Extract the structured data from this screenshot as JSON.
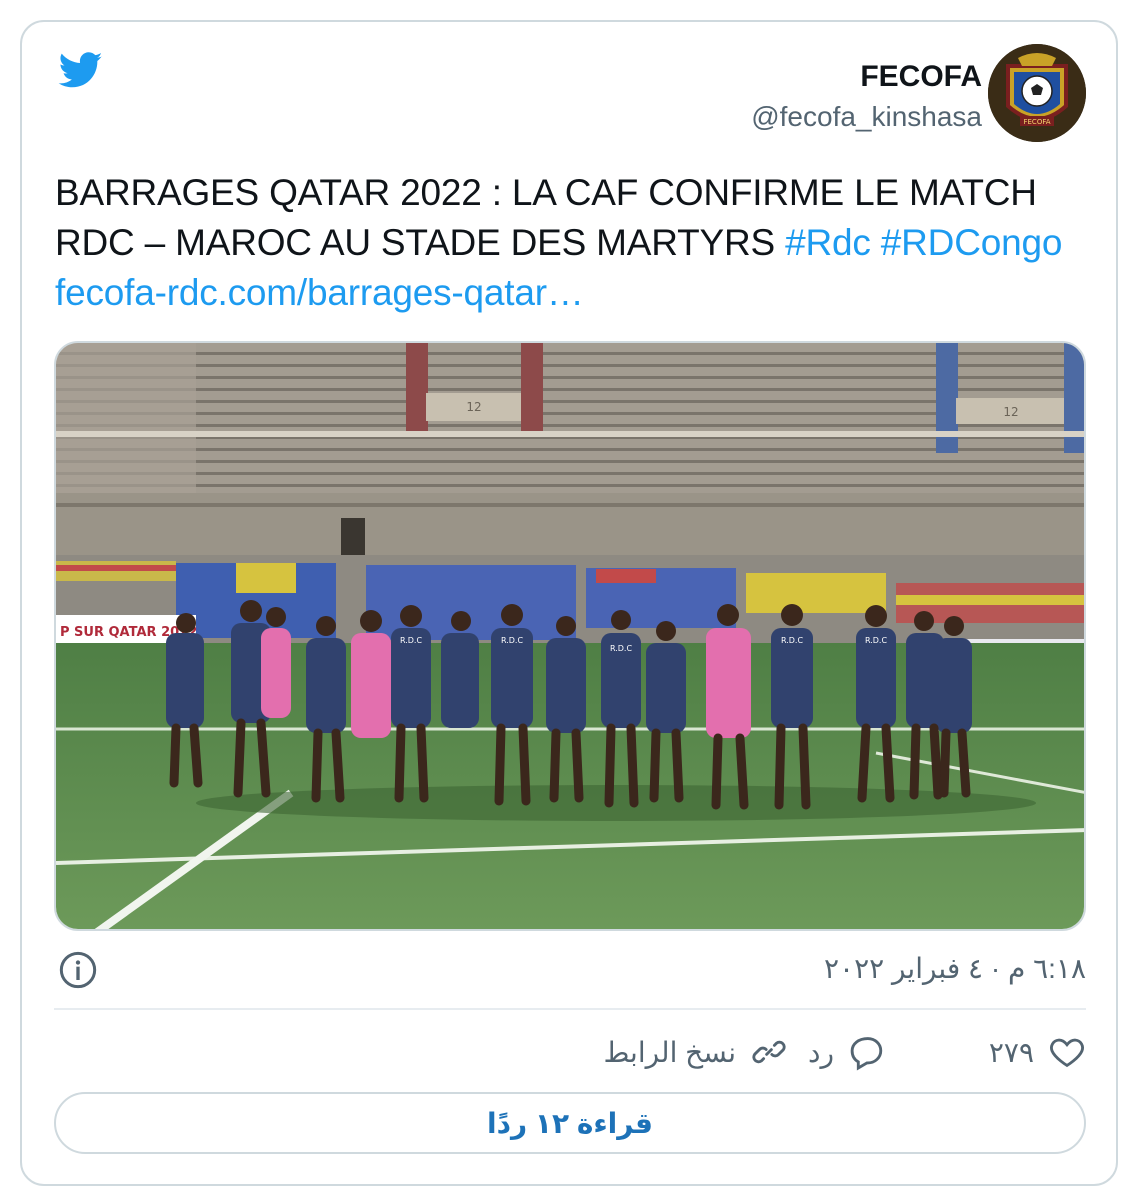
{
  "author": {
    "name": "FECOFA",
    "handle": "@fecofa_kinshasa",
    "avatar_text": "FECOFA"
  },
  "tweet": {
    "text": "BARRAGES QATAR 2022 : LA CAF CONFIRME LE MATCH RDC – MAROC AU STADE DES MARTYRS",
    "hashtags": [
      "#Rdc",
      "#RDCongo"
    ],
    "link": "fecofa-rdc.com/barrages-qatar…"
  },
  "media": {
    "banner_left": "P SUR QATAR 2022",
    "section_number": "12",
    "jersey_text": "R.D.C"
  },
  "meta": {
    "timestamp": "٦:١٨ م · ٤ فبراير ٢٠٢٢"
  },
  "actions": {
    "likes_count": "٢٧٩",
    "reply_label": "رد",
    "copy_link_label": "نسخ الرابط"
  },
  "read_replies_label": "قراءة ١٢ ردًا",
  "colors": {
    "accent": "#1d9bf0",
    "text": "#0f1419",
    "secondary": "#536471",
    "border": "#cfd9de"
  },
  "icons": [
    "twitter-bird-icon",
    "info-icon",
    "heart-icon",
    "reply-bubble-icon",
    "link-icon"
  ]
}
